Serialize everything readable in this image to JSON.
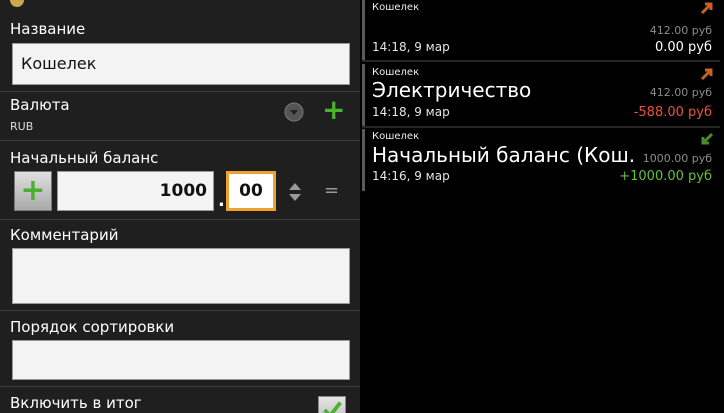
{
  "form": {
    "name_label": "Название",
    "name_value": "Кошелек",
    "currency_label": "Валюта",
    "currency_value": "RUB",
    "initial_balance_label": "Начальный баланс",
    "amount_value": "1000",
    "decimal_separator": ".",
    "cents_value": "00",
    "equals_label": "=",
    "comment_label": "Комментарий",
    "comment_value": "",
    "sort_order_label": "Порядок сортировки",
    "sort_order_value": "",
    "include_total_label": "Включить в итог",
    "include_total_checked": true
  },
  "transactions": [
    {
      "account": "Кошелек",
      "title": "",
      "time": "14:18, 9 мар",
      "balance": "412.00 руб",
      "amount": "0.00 руб",
      "amount_color": "#ffffff",
      "direction": "expense",
      "arrow_color": "#c8602a"
    },
    {
      "account": "Кошелек",
      "title": "Электричество",
      "time": "14:18, 9 мар",
      "balance": "412.00 руб",
      "amount": "-588.00 руб",
      "amount_color": "#e8533a",
      "direction": "expense",
      "arrow_color": "#c8602a"
    },
    {
      "account": "Кошелек",
      "title": "Начальный баланс (Кош.",
      "time": "14:16, 9 мар",
      "balance": "1000.00 руб",
      "amount": "+1000.00 руб",
      "amount_color": "#5fc23a",
      "direction": "income",
      "arrow_color": "#4c8a2e"
    }
  ],
  "icons": {
    "plus": "+",
    "check": "✓"
  },
  "colors": {
    "accent_orange": "#f0a030",
    "plus_green": "#4ab030"
  }
}
